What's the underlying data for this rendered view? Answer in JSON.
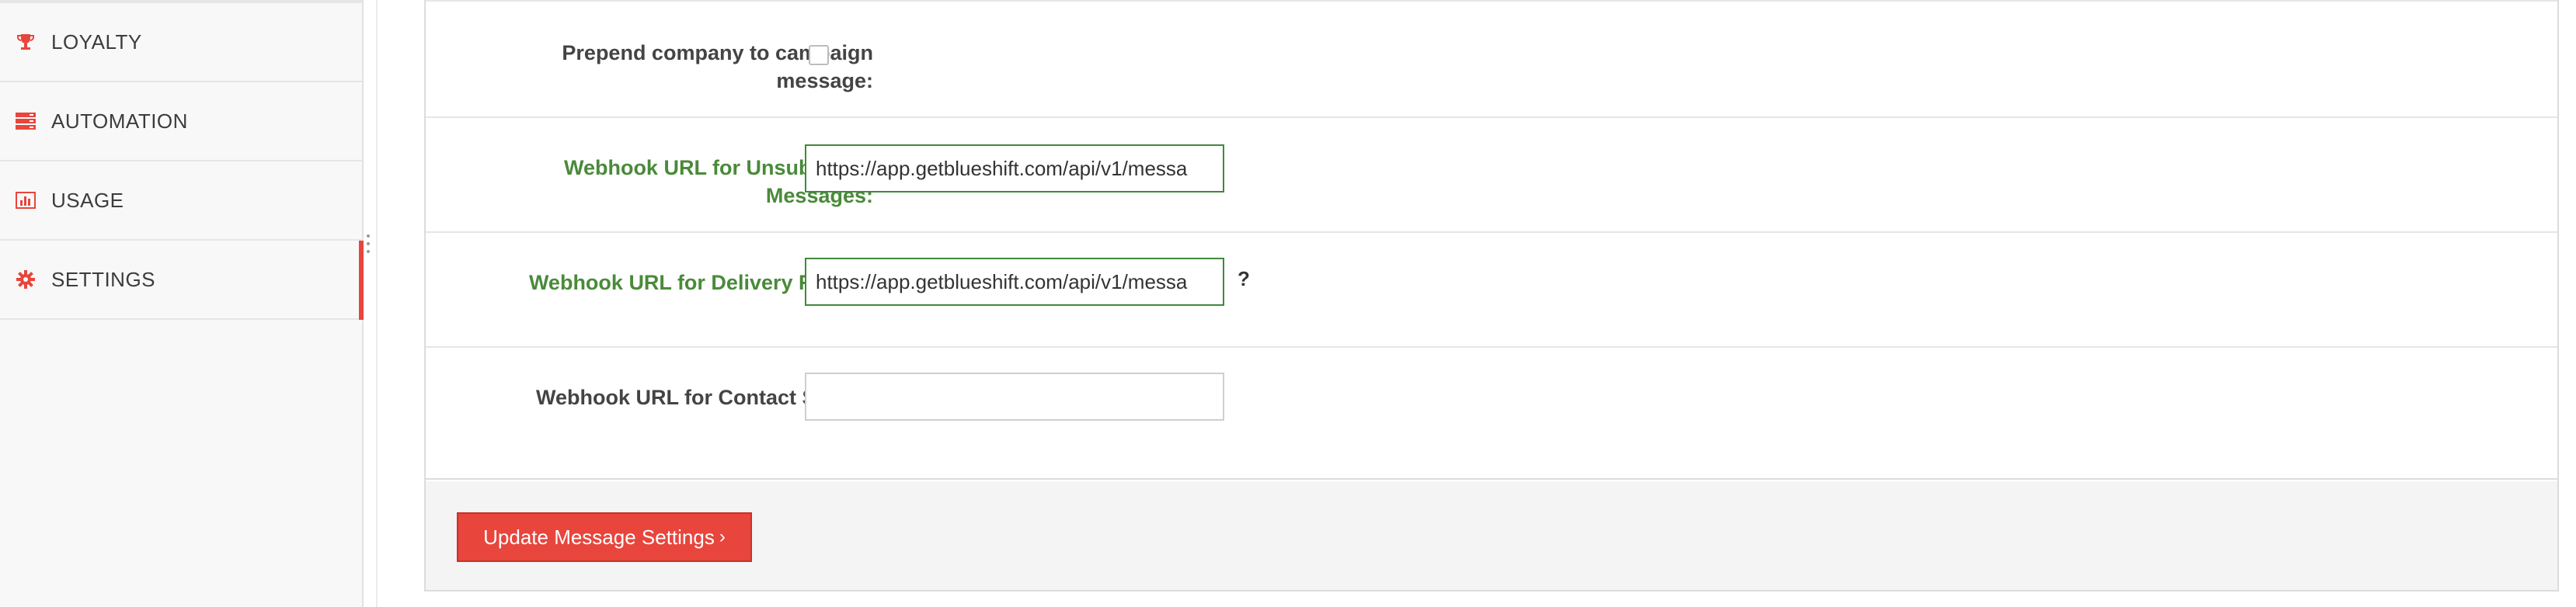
{
  "sidebar": {
    "items": [
      {
        "label": "LOYALTY",
        "icon": "trophy-icon"
      },
      {
        "label": "AUTOMATION",
        "icon": "server-icon"
      },
      {
        "label": "USAGE",
        "icon": "bar-chart-icon"
      },
      {
        "label": "SETTINGS",
        "icon": "gear-icon",
        "active": true
      }
    ]
  },
  "form": {
    "prepend_company": {
      "label": "Prepend company to campaign message:",
      "checked": false
    },
    "webhook_unsubscribe": {
      "label": "Webhook URL for Unsubscribe Messages:",
      "value": "https://app.getblueshift.com/api/v1/messa"
    },
    "webhook_delivery": {
      "label": "Webhook URL for Delivery Report:",
      "value": "https://app.getblueshift.com/api/v1/messa",
      "help": "?"
    },
    "webhook_contact": {
      "label": "Webhook URL for Contact Status:",
      "value": ""
    }
  },
  "footer": {
    "submit_label": "Update Message Settings",
    "submit_chevron": "›"
  },
  "colors": {
    "accent": "#e8453c",
    "valid": "#4a8a3a",
    "valid_border": "#3f8a3a"
  }
}
